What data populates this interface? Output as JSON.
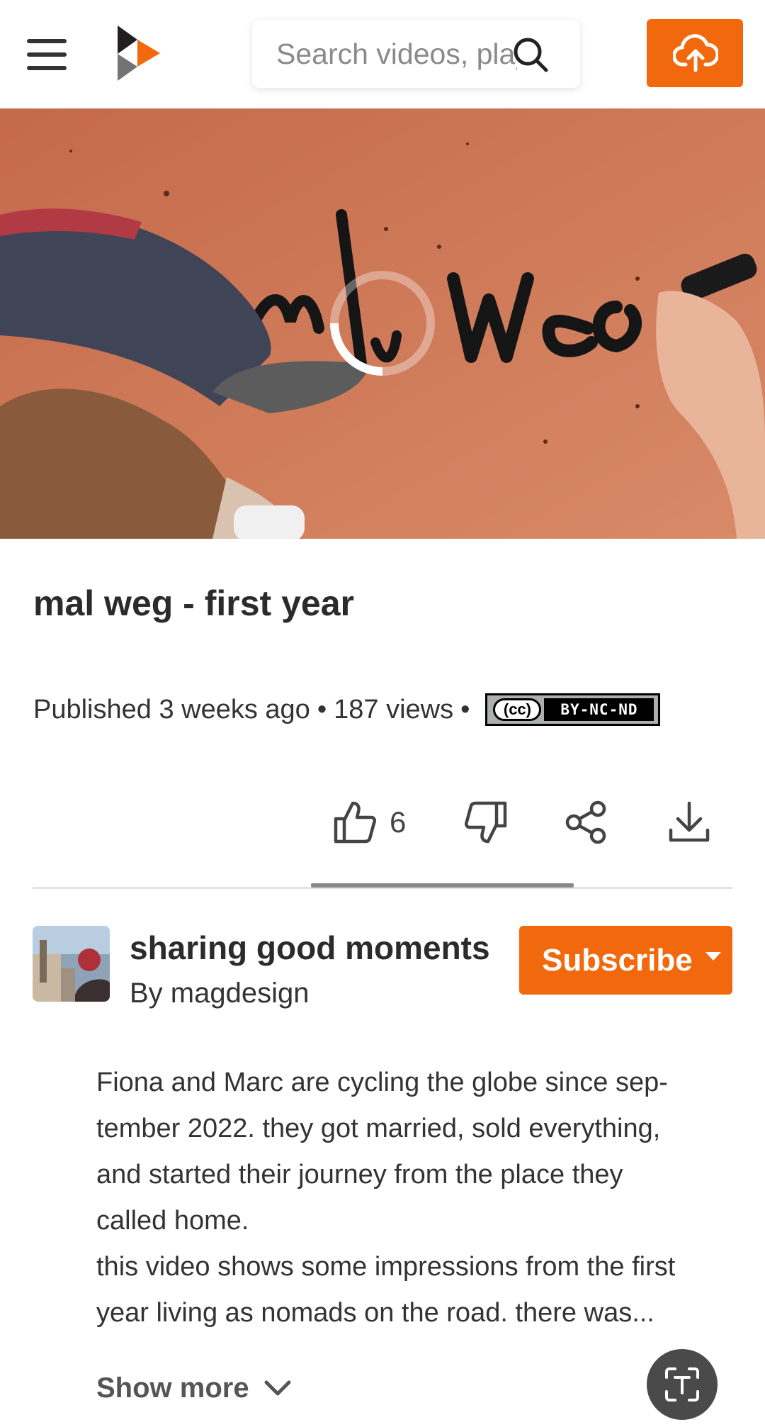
{
  "header": {
    "search_placeholder": "Search videos, playlists, channels…",
    "menu_icon": "hamburger-menu-icon",
    "logo_icon": "peertube-logo",
    "search_icon": "search-icon",
    "upload_icon": "cloud-upload-icon",
    "accent_color": "#f1680d"
  },
  "video": {
    "title": "mal weg - first year",
    "published": "Published 3 weeks ago",
    "views": "187 views",
    "separator": "•",
    "license_cc": "(cc)",
    "license": "BY-NC-ND",
    "loading": true
  },
  "actions": {
    "likes": "6",
    "like_icon": "thumbs-up-icon",
    "dislike_icon": "thumbs-down-icon",
    "share_icon": "share-icon",
    "download_icon": "download-icon"
  },
  "channel": {
    "name": "sharing good moments",
    "by": "By magdesign",
    "subscribe_label": "Subscribe"
  },
  "description": {
    "lines": [
      "Fiona and Marc are cycling the globe since sep-",
      "tember 2022. they got married, sold everything,",
      "and started their journey from the place they",
      "called home.",
      "this video shows some impressions from the first",
      "year living as nomads on the road. there was..."
    ],
    "show_more": "Show more",
    "fab_icon": "text-recognition-icon"
  }
}
